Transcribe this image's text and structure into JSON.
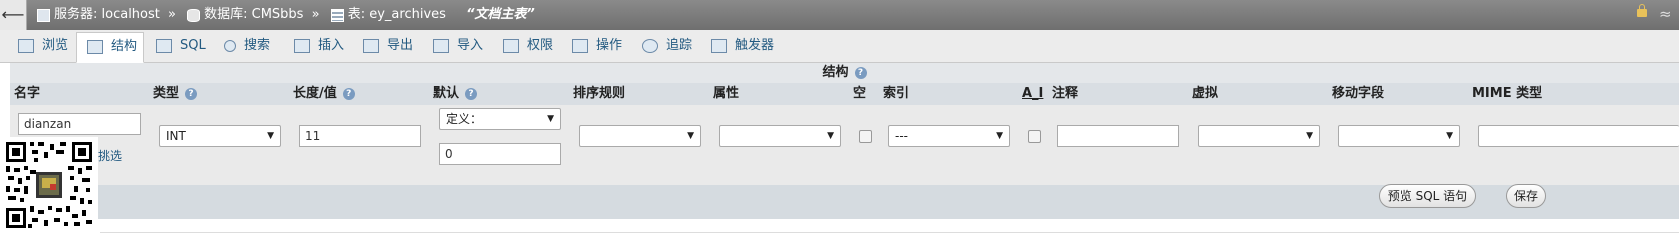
{
  "breadcrumb": {
    "server_label": "服务器: localhost",
    "sep1": "»",
    "database_label": "数据库: CMSbbs",
    "sep2": "»",
    "table_label": "表: ey_archives",
    "table_comment": "“文档主表”"
  },
  "tabs": [
    {
      "label": "浏览",
      "icon": "browse-icon"
    },
    {
      "label": "结构",
      "icon": "structure-icon",
      "active": true
    },
    {
      "label": "SQL",
      "icon": "sql-icon"
    },
    {
      "label": "搜索",
      "icon": "search-icon"
    },
    {
      "label": "插入",
      "icon": "insert-icon"
    },
    {
      "label": "导出",
      "icon": "export-icon"
    },
    {
      "label": "导入",
      "icon": "import-icon"
    },
    {
      "label": "权限",
      "icon": "privileges-icon"
    },
    {
      "label": "操作",
      "icon": "wrench-icon"
    },
    {
      "label": "追踪",
      "icon": "eye-icon"
    },
    {
      "label": "触发器",
      "icon": "triggers-icon"
    }
  ],
  "structure": {
    "title": "结构",
    "columns": {
      "name": "名字",
      "type": "类型",
      "length": "长度/值",
      "default": "默认",
      "collation": "排序规则",
      "attributes": "属性",
      "null": "空",
      "index": "索引",
      "ai": "A_I",
      "comment": "注释",
      "virtual": "虚拟",
      "move": "移动字段",
      "mime": "MIME 类型"
    },
    "row": {
      "name_value": "dianzan",
      "select_label_partial": "挑选",
      "type_value": "INT",
      "length_value": "11",
      "default_select": "定义：",
      "default_value": "0",
      "collation_value": "",
      "attributes_value": "",
      "index_value": "---",
      "comment_value": "",
      "virtual_value": "",
      "move_value": ""
    }
  },
  "footer": {
    "preview_sql": "预览 SQL 语句",
    "save": "保存"
  },
  "colors": {
    "topbar": "#777777",
    "tab_text": "#235a81",
    "panel": "#d9dee3"
  }
}
